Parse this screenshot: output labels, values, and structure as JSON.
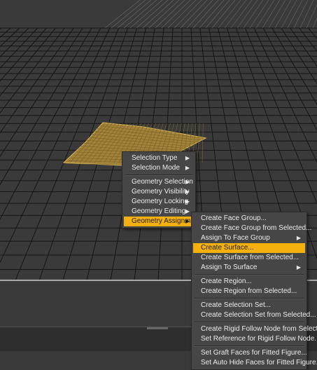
{
  "context_menu": {
    "items": [
      {
        "label": "Selection Type",
        "submenu": true
      },
      {
        "label": "Selection Mode",
        "submenu": true
      },
      {
        "separator": true
      },
      {
        "label": "Geometry Selection",
        "submenu": true
      },
      {
        "label": "Geometry Visibility",
        "submenu": true
      },
      {
        "label": "Geometry Locking",
        "submenu": true
      },
      {
        "label": "Geometry Editing",
        "submenu": true
      },
      {
        "label": "Geometry Assignment",
        "submenu": true,
        "highlighted": true
      }
    ]
  },
  "submenu": {
    "items": [
      {
        "label": "Create Face Group..."
      },
      {
        "label": "Create Face Group from Selected..."
      },
      {
        "label": "Assign To Face Group",
        "submenu": true
      },
      {
        "label": "Create Surface...",
        "highlighted": true
      },
      {
        "label": "Create Surface from Selected..."
      },
      {
        "label": "Assign To Surface",
        "submenu": true
      },
      {
        "separator": true
      },
      {
        "label": "Create Region..."
      },
      {
        "label": "Create Region from Selected..."
      },
      {
        "separator": true
      },
      {
        "label": "Create Selection Set..."
      },
      {
        "label": "Create Selection Set from Selected..."
      },
      {
        "separator": true
      },
      {
        "label": "Create Rigid Follow Node from Selected..."
      },
      {
        "label": "Set Reference for Rigid Follow Node..."
      },
      {
        "separator": true
      },
      {
        "label": "Set Graft Faces for Fitted Figure..."
      },
      {
        "label": "Set Auto Hide Faces for Fitted Figure..."
      }
    ]
  },
  "colors": {
    "viewport_bg": "#3a3a3a",
    "grid_line": "#151515",
    "selection_fill": "#c9a23a",
    "menu_bg": "#464646",
    "menu_highlight": "#f3b00e",
    "menu_text": "#ececec"
  },
  "icons": {
    "submenu_arrow": "triangle-right-icon"
  }
}
